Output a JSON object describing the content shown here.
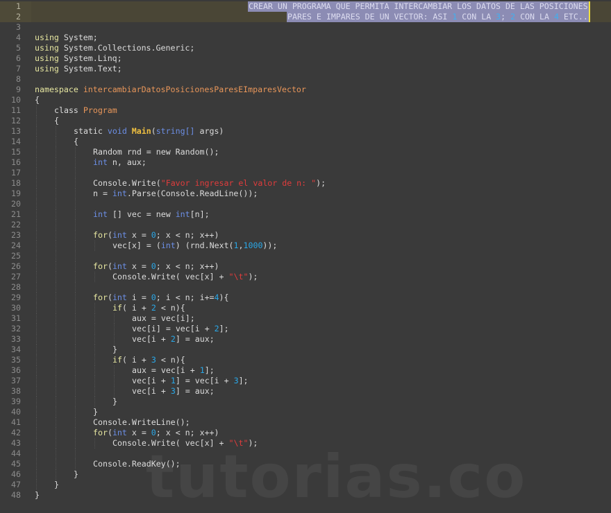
{
  "editor": {
    "header_comment": {
      "line1": "CREAR UN PROGRAMA QUE PERMITA INTERCAMBIAR LOS DATOS DE LAS POSICIONES",
      "line2_parts": [
        "PARES E IMPARES DE UN VECTOR: ASI ",
        "1",
        " CON LA ",
        "3",
        "; ",
        "2",
        " CON LA ",
        "4",
        " ETC.."
      ]
    },
    "lines": [
      {
        "n": "1",
        "hl": true,
        "indent": 0,
        "tokens": []
      },
      {
        "n": "2",
        "hl": true,
        "indent": 0,
        "tokens": []
      },
      {
        "n": "3",
        "indent": 0,
        "tokens": []
      },
      {
        "n": "4",
        "indent": 0,
        "tokens": [
          [
            "kw",
            "using"
          ],
          [
            "plain",
            " System;"
          ]
        ]
      },
      {
        "n": "5",
        "indent": 0,
        "tokens": [
          [
            "kw",
            "using"
          ],
          [
            "plain",
            " System.Collections.Generic;"
          ]
        ]
      },
      {
        "n": "6",
        "indent": 0,
        "tokens": [
          [
            "kw",
            "using"
          ],
          [
            "plain",
            " System.Linq;"
          ]
        ]
      },
      {
        "n": "7",
        "indent": 0,
        "tokens": [
          [
            "kw",
            "using"
          ],
          [
            "plain",
            " System.Text;"
          ]
        ]
      },
      {
        "n": "8",
        "indent": 0,
        "tokens": []
      },
      {
        "n": "9",
        "indent": 0,
        "tokens": [
          [
            "kw",
            "namespace"
          ],
          [
            "plain",
            " "
          ],
          [
            "cls",
            "intercambiarDatosPosicionesParesEImparesVector"
          ]
        ]
      },
      {
        "n": "10",
        "indent": 0,
        "tokens": [
          [
            "plain",
            "{"
          ]
        ]
      },
      {
        "n": "11",
        "indent": 1,
        "tokens": [
          [
            "plain",
            "class "
          ],
          [
            "cls",
            "Program"
          ]
        ]
      },
      {
        "n": "12",
        "indent": 1,
        "tokens": [
          [
            "plain",
            "{"
          ]
        ]
      },
      {
        "n": "13",
        "indent": 2,
        "tokens": [
          [
            "plain",
            "static "
          ],
          [
            "ty",
            "void"
          ],
          [
            "plain",
            " "
          ],
          [
            "fn",
            "Main"
          ],
          [
            "plain",
            "("
          ],
          [
            "ty",
            "string[]"
          ],
          [
            "plain",
            " args)"
          ]
        ]
      },
      {
        "n": "14",
        "indent": 2,
        "tokens": [
          [
            "plain",
            "{"
          ]
        ]
      },
      {
        "n": "15",
        "indent": 3,
        "tokens": [
          [
            "plain",
            "Random rnd = new Random();"
          ]
        ]
      },
      {
        "n": "16",
        "indent": 3,
        "tokens": [
          [
            "ty",
            "int"
          ],
          [
            "plain",
            " n, aux;"
          ]
        ]
      },
      {
        "n": "17",
        "indent": 3,
        "tokens": []
      },
      {
        "n": "18",
        "indent": 3,
        "tokens": [
          [
            "plain",
            "Console.Write("
          ],
          [
            "str",
            "\"Favor ingresar el valor de n: \""
          ],
          [
            "plain",
            ");"
          ]
        ]
      },
      {
        "n": "19",
        "indent": 3,
        "tokens": [
          [
            "plain",
            "n = "
          ],
          [
            "ty",
            "int"
          ],
          [
            "plain",
            ".Parse(Console.ReadLine());"
          ]
        ]
      },
      {
        "n": "20",
        "indent": 3,
        "tokens": []
      },
      {
        "n": "21",
        "indent": 3,
        "tokens": [
          [
            "ty",
            "int"
          ],
          [
            "plain",
            " [] vec = new "
          ],
          [
            "ty",
            "int"
          ],
          [
            "plain",
            "[n];"
          ]
        ]
      },
      {
        "n": "22",
        "indent": 3,
        "tokens": []
      },
      {
        "n": "23",
        "indent": 3,
        "tokens": [
          [
            "kw",
            "for"
          ],
          [
            "plain",
            "("
          ],
          [
            "ty",
            "int"
          ],
          [
            "plain",
            " x = "
          ],
          [
            "num",
            "0"
          ],
          [
            "plain",
            "; x < n; x++)"
          ]
        ]
      },
      {
        "n": "24",
        "indent": 4,
        "tokens": [
          [
            "plain",
            "vec[x] = ("
          ],
          [
            "ty",
            "int"
          ],
          [
            "plain",
            ") (rnd.Next("
          ],
          [
            "num",
            "1"
          ],
          [
            "plain",
            ","
          ],
          [
            "num",
            "1000"
          ],
          [
            "plain",
            "));"
          ]
        ]
      },
      {
        "n": "25",
        "indent": 3,
        "tokens": []
      },
      {
        "n": "26",
        "indent": 3,
        "tokens": [
          [
            "kw",
            "for"
          ],
          [
            "plain",
            "("
          ],
          [
            "ty",
            "int"
          ],
          [
            "plain",
            " x = "
          ],
          [
            "num",
            "0"
          ],
          [
            "plain",
            "; x < n; x++)"
          ]
        ]
      },
      {
        "n": "27",
        "indent": 4,
        "tokens": [
          [
            "plain",
            "Console.Write( vec[x] + "
          ],
          [
            "str",
            "\"\\t\""
          ],
          [
            "plain",
            ");"
          ]
        ]
      },
      {
        "n": "28",
        "indent": 3,
        "tokens": []
      },
      {
        "n": "29",
        "indent": 3,
        "tokens": [
          [
            "kw",
            "for"
          ],
          [
            "plain",
            "("
          ],
          [
            "ty",
            "int"
          ],
          [
            "plain",
            " i = "
          ],
          [
            "num",
            "0"
          ],
          [
            "plain",
            "; i < n; i+="
          ],
          [
            "num",
            "4"
          ],
          [
            "plain",
            "){"
          ]
        ]
      },
      {
        "n": "30",
        "indent": 4,
        "tokens": [
          [
            "kw",
            "if"
          ],
          [
            "plain",
            "( i + "
          ],
          [
            "num",
            "2"
          ],
          [
            "plain",
            " < n){"
          ]
        ]
      },
      {
        "n": "31",
        "indent": 5,
        "tokens": [
          [
            "plain",
            "aux = vec[i];"
          ]
        ]
      },
      {
        "n": "32",
        "indent": 5,
        "tokens": [
          [
            "plain",
            "vec[i] = vec[i + "
          ],
          [
            "num",
            "2"
          ],
          [
            "plain",
            "];"
          ]
        ]
      },
      {
        "n": "33",
        "indent": 5,
        "tokens": [
          [
            "plain",
            "vec[i + "
          ],
          [
            "num",
            "2"
          ],
          [
            "plain",
            "] = aux;"
          ]
        ]
      },
      {
        "n": "34",
        "indent": 4,
        "tokens": [
          [
            "plain",
            "}"
          ]
        ]
      },
      {
        "n": "35",
        "indent": 4,
        "tokens": [
          [
            "kw",
            "if"
          ],
          [
            "plain",
            "( i + "
          ],
          [
            "num",
            "3"
          ],
          [
            "plain",
            " < n){"
          ]
        ]
      },
      {
        "n": "36",
        "indent": 5,
        "tokens": [
          [
            "plain",
            "aux = vec[i + "
          ],
          [
            "num",
            "1"
          ],
          [
            "plain",
            "];"
          ]
        ]
      },
      {
        "n": "37",
        "indent": 5,
        "tokens": [
          [
            "plain",
            "vec[i + "
          ],
          [
            "num",
            "1"
          ],
          [
            "plain",
            "] = vec[i + "
          ],
          [
            "num",
            "3"
          ],
          [
            "plain",
            "];"
          ]
        ]
      },
      {
        "n": "38",
        "indent": 5,
        "tokens": [
          [
            "plain",
            "vec[i + "
          ],
          [
            "num",
            "3"
          ],
          [
            "plain",
            "] = aux;"
          ]
        ]
      },
      {
        "n": "39",
        "indent": 4,
        "tokens": [
          [
            "plain",
            "}"
          ]
        ]
      },
      {
        "n": "40",
        "indent": 3,
        "tokens": [
          [
            "plain",
            "}"
          ]
        ]
      },
      {
        "n": "41",
        "indent": 3,
        "tokens": [
          [
            "plain",
            "Console.WriteLine();"
          ]
        ]
      },
      {
        "n": "42",
        "indent": 3,
        "tokens": [
          [
            "kw",
            "for"
          ],
          [
            "plain",
            "("
          ],
          [
            "ty",
            "int"
          ],
          [
            "plain",
            " x = "
          ],
          [
            "num",
            "0"
          ],
          [
            "plain",
            "; x < n; x++)"
          ]
        ]
      },
      {
        "n": "43",
        "indent": 4,
        "tokens": [
          [
            "plain",
            "Console.Write( vec[x] + "
          ],
          [
            "str",
            "\"\\t\""
          ],
          [
            "plain",
            ");"
          ]
        ]
      },
      {
        "n": "44",
        "indent": 3,
        "tokens": []
      },
      {
        "n": "45",
        "indent": 3,
        "tokens": [
          [
            "plain",
            "Console.ReadKey();"
          ]
        ]
      },
      {
        "n": "46",
        "indent": 2,
        "tokens": [
          [
            "plain",
            "}"
          ]
        ]
      },
      {
        "n": "47",
        "indent": 1,
        "tokens": [
          [
            "plain",
            "}"
          ]
        ]
      },
      {
        "n": "48",
        "indent": 0,
        "tokens": [
          [
            "plain",
            "}"
          ]
        ]
      }
    ]
  },
  "watermark": "tutorias.co",
  "colors": {
    "background": "#3a3a3a",
    "keyword": "#e6e6a0",
    "type": "#6c8fe6",
    "class": "#e8965a",
    "method": "#f0c040",
    "string": "#e03c3c",
    "number": "#2aa8e8",
    "selection": "#8c8cb4"
  }
}
